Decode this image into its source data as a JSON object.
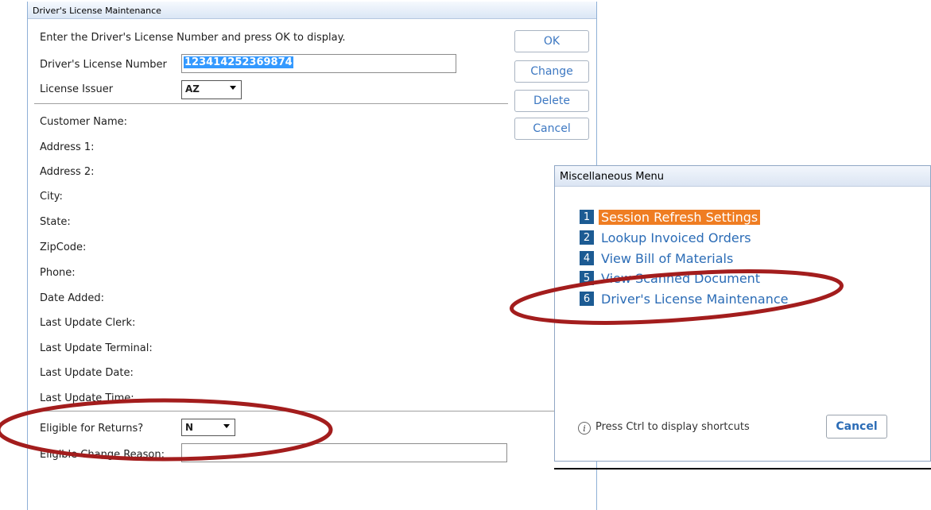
{
  "dl_window": {
    "title": "Driver's License Maintenance",
    "instruction": "Enter the Driver's License Number and press OK to display.",
    "dl_number_label": "Driver's License Number",
    "dl_number_value": "123414252369874",
    "issuer_label": "License Issuer",
    "issuer_value": "AZ",
    "buttons": {
      "ok": "OK",
      "change": "Change",
      "delete": "Delete",
      "cancel": "Cancel"
    },
    "fields": [
      "Customer Name:",
      "Address 1:",
      "Address 2:",
      "City:",
      "State:",
      "ZipCode:",
      "Phone:",
      "Date Added:",
      "Last Update Clerk:",
      "Last Update Terminal:",
      "Last Update Date:",
      "Last Update Time:"
    ],
    "eligible_label": "Eligible for Returns?",
    "eligible_value": "N",
    "eligible_reason_label": "Eligible Change Reason:"
  },
  "misc_menu": {
    "title": "Miscellaneous Menu",
    "items": [
      {
        "num": "1",
        "label": "Session Refresh Settings",
        "selected": true
      },
      {
        "num": "2",
        "label": "Lookup Invoiced Orders"
      },
      {
        "num": "4",
        "label": "View Bill of Materials"
      },
      {
        "num": "5",
        "label": "View Scanned Document"
      },
      {
        "num": "6",
        "label": "Driver's License Maintenance"
      }
    ],
    "hint": "Press Ctrl to display shortcuts",
    "info_glyph": "i",
    "cancel": "Cancel"
  },
  "colors": {
    "accent_orange": "#ef7d22",
    "badge_blue": "#1c5b93",
    "link_blue": "#2b6cb6",
    "annotation_red": "#a31d1d"
  }
}
